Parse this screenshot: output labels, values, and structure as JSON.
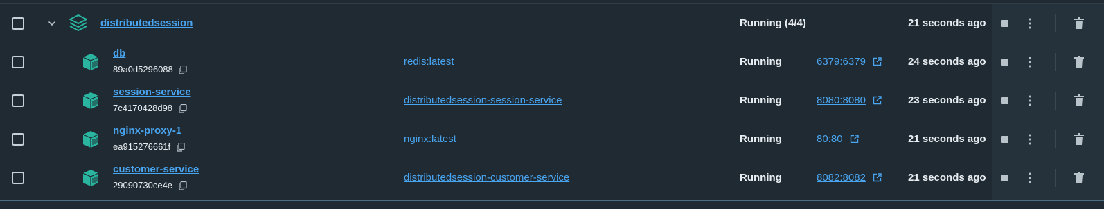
{
  "colors": {
    "background": "#1f2a32",
    "link": "#4aa5f0",
    "icon_teal": "#2ab5a0",
    "text": "#e8edf1"
  },
  "group": {
    "name": "distributedsession",
    "status": "Running (4/4)",
    "time": "21 seconds ago",
    "icon": "stack-icon"
  },
  "containers": [
    {
      "name": "db",
      "id": "89a0d5296088",
      "image": "redis:latest",
      "status": "Running",
      "port": "6379:6379",
      "time": "24 seconds ago"
    },
    {
      "name": "session-service",
      "id": "7c4170428d98",
      "image": "distributedsession-session-service",
      "status": "Running",
      "port": "8080:8080",
      "time": "23 seconds ago"
    },
    {
      "name": "nginx-proxy-1",
      "id": "ea915276661f",
      "image": "nginx:latest",
      "status": "Running",
      "port": "80:80",
      "time": "21 seconds ago"
    },
    {
      "name": "customer-service",
      "id": "29090730ce4e",
      "image": "distributedsession-customer-service",
      "status": "Running",
      "port": "8082:8082",
      "time": "21 seconds ago"
    }
  ]
}
